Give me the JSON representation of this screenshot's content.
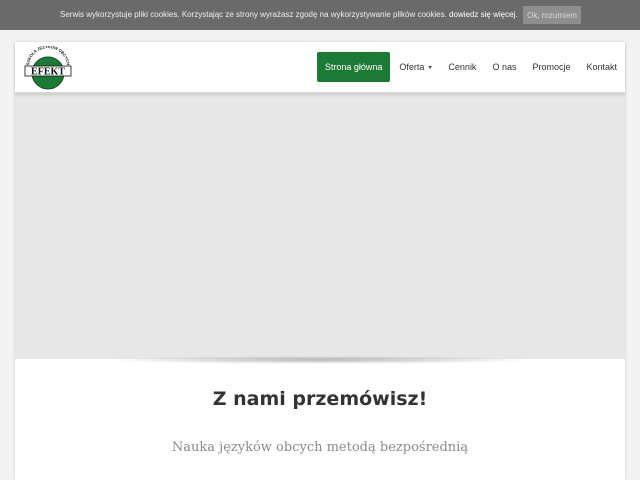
{
  "cookie_bar": {
    "text": "Serwis wykorzystuje pliki cookies. Korzystając ze strony wyrażasz zgodę na wykorzystywanie plików cookies.",
    "link": "dowiedz się więcej",
    "suffix": ".",
    "accept_button": "Ok, rozumiem"
  },
  "logo": {
    "arc_text": "SZKOŁA JĘZYKÓW OBCYCH",
    "name": "EFEKT",
    "colors": {
      "green": "#1b7a35",
      "black": "#111111"
    }
  },
  "nav": {
    "items": [
      {
        "label": "Strona główna",
        "active": true
      },
      {
        "label": "Oferta",
        "dropdown": true
      },
      {
        "label": "Cennik"
      },
      {
        "label": "O nas"
      },
      {
        "label": "Promocje"
      },
      {
        "label": "Kontakt"
      }
    ],
    "accent_color": "#1b7a35"
  },
  "content": {
    "headline": "Z nami przemówisz!",
    "subheadline": "Nauka języków obcych metodą bezpośrednią"
  }
}
